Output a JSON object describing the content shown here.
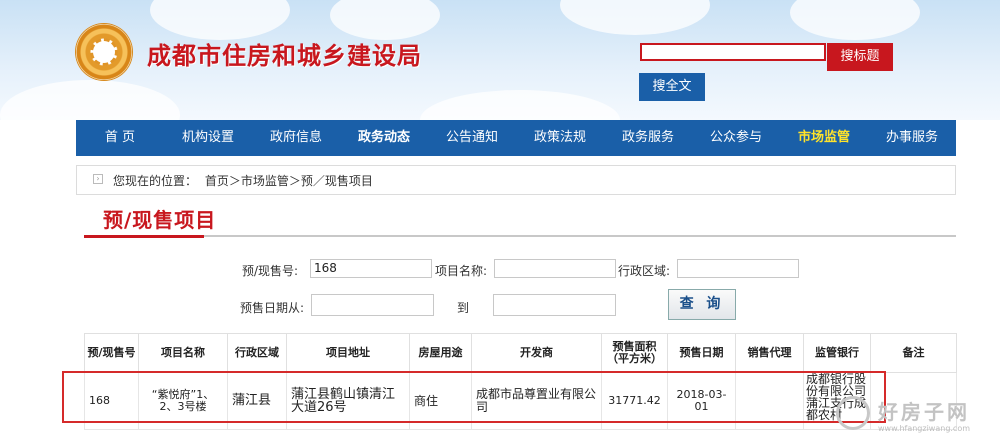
{
  "header": {
    "site_title": "成都市住房和城乡建设局",
    "search_title_btn": "搜标题",
    "search_full_btn": "搜全文"
  },
  "nav": {
    "items": [
      "首 页",
      "机构设置",
      "政府信息",
      "政务动态",
      "公告通知",
      "政策法规",
      "政务服务",
      "公众参与",
      "市场监管",
      "办事服务"
    ],
    "active": "市场监管"
  },
  "breadcrumb": {
    "prefix": "您现在的位置：",
    "path": "首页＞市场监管＞预／现售项目"
  },
  "page_heading": "预/现售项目",
  "form": {
    "presale_no_label": "预/现售号:",
    "presale_no_value": "168",
    "project_name_label": "项目名称:",
    "district_label": "行政区域:",
    "date_from_label": "预售日期从:",
    "date_to_label": "到",
    "query_btn": "查 询"
  },
  "table": {
    "headers": [
      "预/现售号",
      "项目名称",
      "行政区域",
      "项目地址",
      "房屋用途",
      "开发商",
      "预售面积（平方米）",
      "预售日期",
      "销售代理",
      "监管银行",
      "备注"
    ],
    "row": {
      "presale_no": "168",
      "project_name": "“紫悦府”1、2、3号楼",
      "district": "蒲江县",
      "address": "蒲江县鹤山镇清江大道26号",
      "usage": "商住",
      "developer": "成都市品尊置业有限公司",
      "area": "31771.42",
      "date": "2018-03-01",
      "agent": "",
      "bank": "成都银行股份有限公司蒲江支行成都农村"
    }
  },
  "watermark": {
    "text": "好房子网",
    "url": "www.hfangziwang.com"
  },
  "colors": {
    "brand_red": "#c8171e",
    "nav_blue": "#1a5fa8",
    "nav_active": "#ffe32a"
  }
}
